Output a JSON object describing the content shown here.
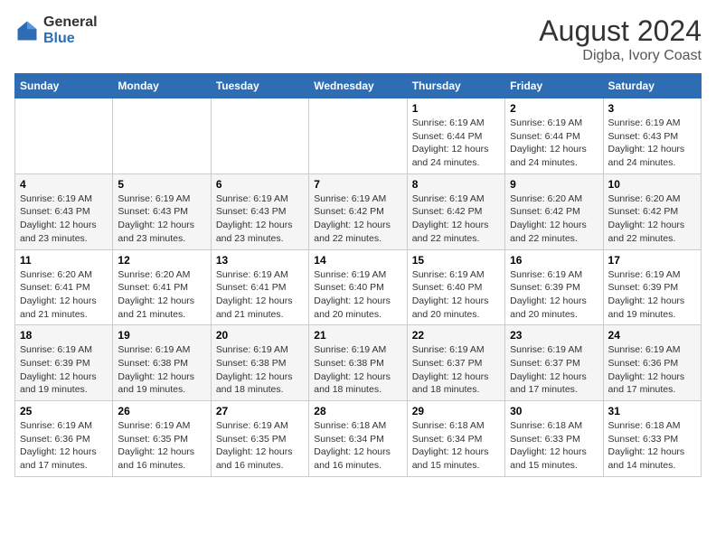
{
  "logo": {
    "general": "General",
    "blue": "Blue"
  },
  "title": "August 2024",
  "subtitle": "Digba, Ivory Coast",
  "days_of_week": [
    "Sunday",
    "Monday",
    "Tuesday",
    "Wednesday",
    "Thursday",
    "Friday",
    "Saturday"
  ],
  "weeks": [
    [
      {
        "day": "",
        "info": ""
      },
      {
        "day": "",
        "info": ""
      },
      {
        "day": "",
        "info": ""
      },
      {
        "day": "",
        "info": ""
      },
      {
        "day": "1",
        "info": "Sunrise: 6:19 AM\nSunset: 6:44 PM\nDaylight: 12 hours and 24 minutes."
      },
      {
        "day": "2",
        "info": "Sunrise: 6:19 AM\nSunset: 6:44 PM\nDaylight: 12 hours and 24 minutes."
      },
      {
        "day": "3",
        "info": "Sunrise: 6:19 AM\nSunset: 6:43 PM\nDaylight: 12 hours and 24 minutes."
      }
    ],
    [
      {
        "day": "4",
        "info": "Sunrise: 6:19 AM\nSunset: 6:43 PM\nDaylight: 12 hours and 23 minutes."
      },
      {
        "day": "5",
        "info": "Sunrise: 6:19 AM\nSunset: 6:43 PM\nDaylight: 12 hours and 23 minutes."
      },
      {
        "day": "6",
        "info": "Sunrise: 6:19 AM\nSunset: 6:43 PM\nDaylight: 12 hours and 23 minutes."
      },
      {
        "day": "7",
        "info": "Sunrise: 6:19 AM\nSunset: 6:42 PM\nDaylight: 12 hours and 22 minutes."
      },
      {
        "day": "8",
        "info": "Sunrise: 6:19 AM\nSunset: 6:42 PM\nDaylight: 12 hours and 22 minutes."
      },
      {
        "day": "9",
        "info": "Sunrise: 6:20 AM\nSunset: 6:42 PM\nDaylight: 12 hours and 22 minutes."
      },
      {
        "day": "10",
        "info": "Sunrise: 6:20 AM\nSunset: 6:42 PM\nDaylight: 12 hours and 22 minutes."
      }
    ],
    [
      {
        "day": "11",
        "info": "Sunrise: 6:20 AM\nSunset: 6:41 PM\nDaylight: 12 hours and 21 minutes."
      },
      {
        "day": "12",
        "info": "Sunrise: 6:20 AM\nSunset: 6:41 PM\nDaylight: 12 hours and 21 minutes."
      },
      {
        "day": "13",
        "info": "Sunrise: 6:19 AM\nSunset: 6:41 PM\nDaylight: 12 hours and 21 minutes."
      },
      {
        "day": "14",
        "info": "Sunrise: 6:19 AM\nSunset: 6:40 PM\nDaylight: 12 hours and 20 minutes."
      },
      {
        "day": "15",
        "info": "Sunrise: 6:19 AM\nSunset: 6:40 PM\nDaylight: 12 hours and 20 minutes."
      },
      {
        "day": "16",
        "info": "Sunrise: 6:19 AM\nSunset: 6:39 PM\nDaylight: 12 hours and 20 minutes."
      },
      {
        "day": "17",
        "info": "Sunrise: 6:19 AM\nSunset: 6:39 PM\nDaylight: 12 hours and 19 minutes."
      }
    ],
    [
      {
        "day": "18",
        "info": "Sunrise: 6:19 AM\nSunset: 6:39 PM\nDaylight: 12 hours and 19 minutes."
      },
      {
        "day": "19",
        "info": "Sunrise: 6:19 AM\nSunset: 6:38 PM\nDaylight: 12 hours and 19 minutes."
      },
      {
        "day": "20",
        "info": "Sunrise: 6:19 AM\nSunset: 6:38 PM\nDaylight: 12 hours and 18 minutes."
      },
      {
        "day": "21",
        "info": "Sunrise: 6:19 AM\nSunset: 6:38 PM\nDaylight: 12 hours and 18 minutes."
      },
      {
        "day": "22",
        "info": "Sunrise: 6:19 AM\nSunset: 6:37 PM\nDaylight: 12 hours and 18 minutes."
      },
      {
        "day": "23",
        "info": "Sunrise: 6:19 AM\nSunset: 6:37 PM\nDaylight: 12 hours and 17 minutes."
      },
      {
        "day": "24",
        "info": "Sunrise: 6:19 AM\nSunset: 6:36 PM\nDaylight: 12 hours and 17 minutes."
      }
    ],
    [
      {
        "day": "25",
        "info": "Sunrise: 6:19 AM\nSunset: 6:36 PM\nDaylight: 12 hours and 17 minutes."
      },
      {
        "day": "26",
        "info": "Sunrise: 6:19 AM\nSunset: 6:35 PM\nDaylight: 12 hours and 16 minutes."
      },
      {
        "day": "27",
        "info": "Sunrise: 6:19 AM\nSunset: 6:35 PM\nDaylight: 12 hours and 16 minutes."
      },
      {
        "day": "28",
        "info": "Sunrise: 6:18 AM\nSunset: 6:34 PM\nDaylight: 12 hours and 16 minutes."
      },
      {
        "day": "29",
        "info": "Sunrise: 6:18 AM\nSunset: 6:34 PM\nDaylight: 12 hours and 15 minutes."
      },
      {
        "day": "30",
        "info": "Sunrise: 6:18 AM\nSunset: 6:33 PM\nDaylight: 12 hours and 15 minutes."
      },
      {
        "day": "31",
        "info": "Sunrise: 6:18 AM\nSunset: 6:33 PM\nDaylight: 12 hours and 14 minutes."
      }
    ]
  ]
}
